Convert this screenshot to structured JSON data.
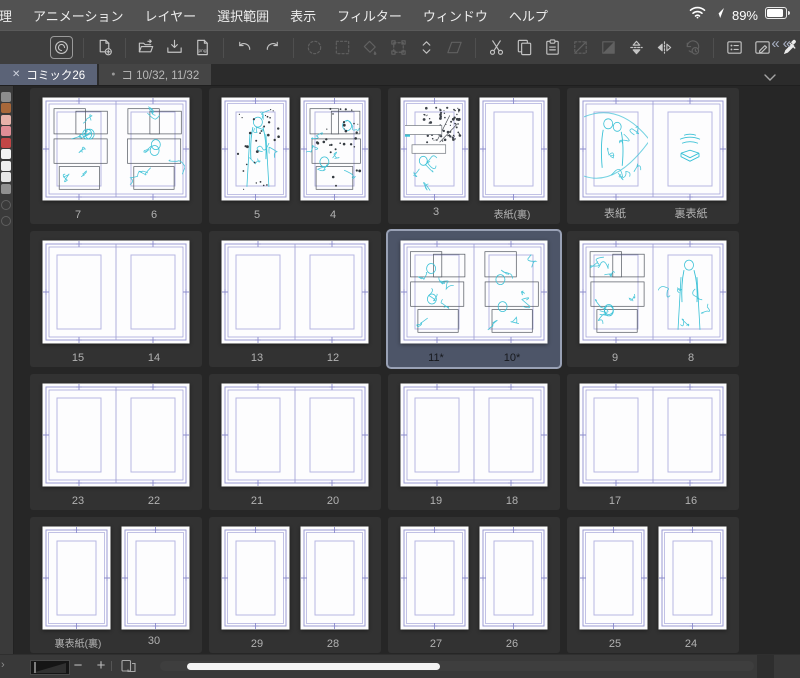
{
  "menu_bar": {
    "items": [
      "理",
      "アニメーション",
      "レイヤー",
      "選択範囲",
      "表示",
      "フィルター",
      "ウィンドウ",
      "ヘルプ"
    ],
    "status": {
      "battery_percent": "89%",
      "icons": [
        "wifi-icon",
        "location-icon",
        "battery-icon"
      ]
    }
  },
  "toolbar": {
    "collapse_label": "««",
    "groups": [
      [
        "app-logo"
      ],
      [
        "new-page"
      ],
      [
        "open-file",
        "save-export",
        "export-png"
      ],
      [
        "undo",
        "redo"
      ],
      [
        "deselect",
        "select-rect",
        "fill-tool",
        "transform-frame",
        "expand-updown",
        "skew-transform"
      ],
      [
        "cut",
        "copy",
        "paste",
        "crop-frame",
        "mask-fill",
        "flip-vertical",
        "flip-horizontal",
        "rotate-clock"
      ],
      [
        "panel-settings",
        "edit-window",
        "eyedropper"
      ]
    ],
    "disabled": [
      "deselect",
      "select-rect",
      "fill-tool",
      "transform-frame",
      "skew-transform",
      "crop-frame",
      "mask-fill",
      "rotate-clock"
    ]
  },
  "tab_bar": {
    "tabs": [
      {
        "label": "コミック26",
        "active": true,
        "close_glyph": "✕"
      },
      {
        "label": "コ 10/32, 11/32",
        "active": false,
        "modified_dot": "●"
      }
    ],
    "overflow_icon": "chevron-down-icon"
  },
  "page_manager": {
    "rows": [
      {
        "spreads": [
          {
            "joined": true,
            "pages": [
              {
                "label": "7",
                "sketch": "manga"
              },
              {
                "label": "6",
                "sketch": "manga"
              }
            ]
          },
          {
            "joined": false,
            "pages": [
              {
                "label": "5",
                "sketch": "figure-speckle"
              },
              {
                "label": "4",
                "sketch": "manga-speckle"
              }
            ]
          },
          {
            "joined": false,
            "pages": [
              {
                "label": "3",
                "sketch": "tree"
              },
              {
                "label": "表紙(裏)",
                "sketch": "none"
              }
            ]
          },
          {
            "joined": true,
            "pages": [
              {
                "label": "表紙",
                "sketch": "cover"
              },
              {
                "label": "裏表紙",
                "sketch": "book"
              }
            ]
          }
        ]
      },
      {
        "spreads": [
          {
            "joined": true,
            "pages": [
              {
                "label": "15",
                "sketch": "none"
              },
              {
                "label": "14",
                "sketch": "none"
              }
            ]
          },
          {
            "joined": true,
            "pages": [
              {
                "label": "13",
                "sketch": "none"
              },
              {
                "label": "12",
                "sketch": "none"
              }
            ]
          },
          {
            "joined": true,
            "selected": true,
            "pages": [
              {
                "label": "11*",
                "sketch": "manga"
              },
              {
                "label": "10*",
                "sketch": "manga"
              }
            ]
          },
          {
            "joined": true,
            "pages": [
              {
                "label": "9",
                "sketch": "manga"
              },
              {
                "label": "8",
                "sketch": "figure"
              }
            ]
          }
        ]
      },
      {
        "spreads": [
          {
            "joined": true,
            "pages": [
              {
                "label": "23",
                "sketch": "none"
              },
              {
                "label": "22",
                "sketch": "none"
              }
            ]
          },
          {
            "joined": true,
            "pages": [
              {
                "label": "21",
                "sketch": "none"
              },
              {
                "label": "20",
                "sketch": "none"
              }
            ]
          },
          {
            "joined": true,
            "pages": [
              {
                "label": "19",
                "sketch": "none"
              },
              {
                "label": "18",
                "sketch": "none"
              }
            ]
          },
          {
            "joined": true,
            "pages": [
              {
                "label": "17",
                "sketch": "none"
              },
              {
                "label": "16",
                "sketch": "none"
              }
            ]
          }
        ]
      },
      {
        "spreads": [
          {
            "joined": false,
            "pages": [
              {
                "label": "裏表紙(裏)",
                "sketch": "none"
              },
              {
                "label": "30",
                "sketch": "none"
              }
            ]
          },
          {
            "joined": false,
            "pages": [
              {
                "label": "29",
                "sketch": "none"
              },
              {
                "label": "28",
                "sketch": "none"
              }
            ]
          },
          {
            "joined": false,
            "pages": [
              {
                "label": "27",
                "sketch": "none"
              },
              {
                "label": "26",
                "sketch": "none"
              }
            ]
          },
          {
            "joined": false,
            "pages": [
              {
                "label": "25",
                "sketch": "none"
              },
              {
                "label": "24",
                "sketch": "none"
              }
            ]
          }
        ]
      }
    ]
  },
  "bottom_bar": {
    "zoom_out": "−",
    "zoom_in": "+",
    "expand_glyph": "›",
    "icons": [
      "zoom-slider",
      "pages-view-icon",
      "horizontal-scrollbar"
    ]
  },
  "left_palette": {
    "swatches": [
      "#8d8d8d",
      "#a8683a",
      "#e6b2aa",
      "#e08e96",
      "#c24646",
      "#f4f4f4",
      "#efefef",
      "#e6e6e6",
      "#909090"
    ]
  },
  "colors": {
    "app_bg": "#262626",
    "panel_bg": "#323232",
    "selection_bg": "#4d5568",
    "selection_border": "#99a1b5",
    "sketch_cyan": "#3ac1d6",
    "trim_purple": "#9a9ad4",
    "frame_purple": "#b7b7e2",
    "page_white": "#fdfdfe",
    "menu_bg": "#525252",
    "toolbar_bg": "#3e3e3e"
  }
}
